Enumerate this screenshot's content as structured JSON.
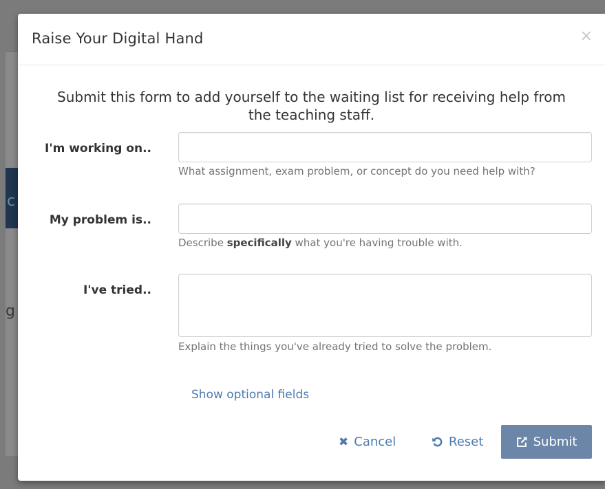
{
  "background": {
    "letter_a": "c",
    "letter_b": "g"
  },
  "modal": {
    "title": "Raise Your Digital Hand",
    "close_icon": "×",
    "intro_line1": "Submit this form to add yourself to the waiting list for receiving help from",
    "intro_line2": "the teaching staff.",
    "fields": {
      "working_on": {
        "label": "I'm working on..",
        "value": "",
        "help": "What assignment, exam problem, or concept do you need help with?"
      },
      "problem": {
        "label": "My problem is..",
        "value": "",
        "help_pre": "Describe ",
        "help_bold": "specifically",
        "help_post": " what you're having trouble with."
      },
      "tried": {
        "label": "I've tried..",
        "value": "",
        "help": "Explain the things you've already tried to solve the problem."
      }
    },
    "optional_link": "Show optional fields",
    "buttons": {
      "cancel": "Cancel",
      "reset": "Reset",
      "submit": "Submit"
    },
    "colors": {
      "link": "#4c7bb0",
      "submit_bg": "#6b86a8"
    }
  }
}
